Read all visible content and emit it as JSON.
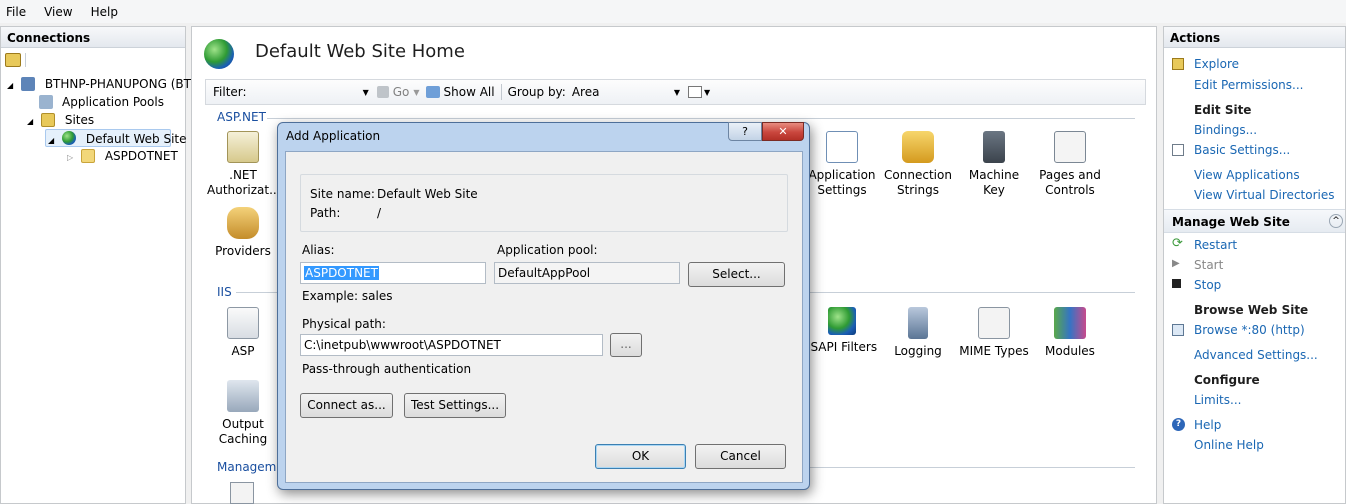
{
  "menu": [
    "File",
    "View",
    "Help"
  ],
  "connections": {
    "header": "Connections",
    "tree": [
      {
        "label": "BTHNP-PHANUPONG (BT(",
        "level": 0
      },
      {
        "label": "Application Pools",
        "level": 1
      },
      {
        "label": "Sites",
        "level": 1
      },
      {
        "label": "Default Web Site",
        "level": 2
      },
      {
        "label": "ASPDOTNET",
        "level": 3
      }
    ]
  },
  "center": {
    "title": "Default Web Site Home",
    "filter": {
      "label": "Filter:",
      "go": "Go",
      "show_all": "Show All",
      "group_by_label": "Group by:",
      "group_by_value": "Area"
    },
    "sections": {
      "aspnet": "ASP.NET",
      "iis": "IIS",
      "management": "Manageme"
    },
    "aspnet_features": [
      {
        "label": ".NET\nAuthorizat..."
      },
      {
        "label": "Providers"
      },
      {
        "label": "Application\nSettings"
      },
      {
        "label": "Connection\nStrings"
      },
      {
        "label": "Machine Key"
      },
      {
        "label": "Pages and\nControls"
      }
    ],
    "iis_features": [
      {
        "label": "ASP"
      },
      {
        "label": "Output\nCaching"
      },
      {
        "label": "ISAPI Filters"
      },
      {
        "label": "Logging"
      },
      {
        "label": "MIME Types"
      },
      {
        "label": "Modules"
      }
    ]
  },
  "actions": {
    "header": "Actions",
    "items": [
      {
        "text": "Explore",
        "type": "link",
        "icon": "explore-icon"
      },
      {
        "text": "Edit Permissions...",
        "type": "link"
      },
      {
        "text": "Edit Site",
        "type": "heading"
      },
      {
        "text": "Bindings...",
        "type": "link"
      },
      {
        "text": "Basic Settings...",
        "type": "link",
        "icon": "basic-settings-icon"
      },
      {
        "text": "View Applications",
        "type": "link"
      },
      {
        "text": "View Virtual Directories",
        "type": "link"
      },
      {
        "text": "Manage Web Site",
        "type": "group"
      },
      {
        "text": "Restart",
        "type": "link",
        "icon": "restart-icon"
      },
      {
        "text": "Start",
        "type": "disabled",
        "icon": "start-icon"
      },
      {
        "text": "Stop",
        "type": "link",
        "icon": "stop-icon"
      },
      {
        "text": "Browse Web Site",
        "type": "heading"
      },
      {
        "text": "Browse *:80 (http)",
        "type": "link",
        "icon": "browse-icon"
      },
      {
        "text": "Advanced Settings...",
        "type": "link"
      },
      {
        "text": "Configure",
        "type": "heading"
      },
      {
        "text": "Limits...",
        "type": "link"
      },
      {
        "text": "Help",
        "type": "link",
        "icon": "help-icon"
      },
      {
        "text": "Online Help",
        "type": "link"
      }
    ]
  },
  "dialog": {
    "title": "Add Application",
    "help_glyph": "?",
    "close_glyph": "✕",
    "site_name_label": "Site name:",
    "site_name_value": "Default Web Site",
    "path_label": "Path:",
    "path_value": "/",
    "alias_label": "Alias:",
    "alias_value": "ASPDOTNET",
    "app_pool_label": "Application pool:",
    "app_pool_value": "DefaultAppPool",
    "select_button": "Select...",
    "example": "Example: sales",
    "physical_path_label": "Physical path:",
    "physical_path_value": "C:\\inetpub\\wwwroot\\ASPDOTNET",
    "browse_button": "...",
    "pass_through": "Pass-through authentication",
    "connect_as_button": "Connect as...",
    "test_settings_button": "Test Settings...",
    "ok_button": "OK",
    "cancel_button": "Cancel"
  },
  "colors": {
    "link": "#1a67b3",
    "dialog_frame": "#bcd3ee",
    "close_red": "#c9463d",
    "selection": "#3399ff"
  }
}
